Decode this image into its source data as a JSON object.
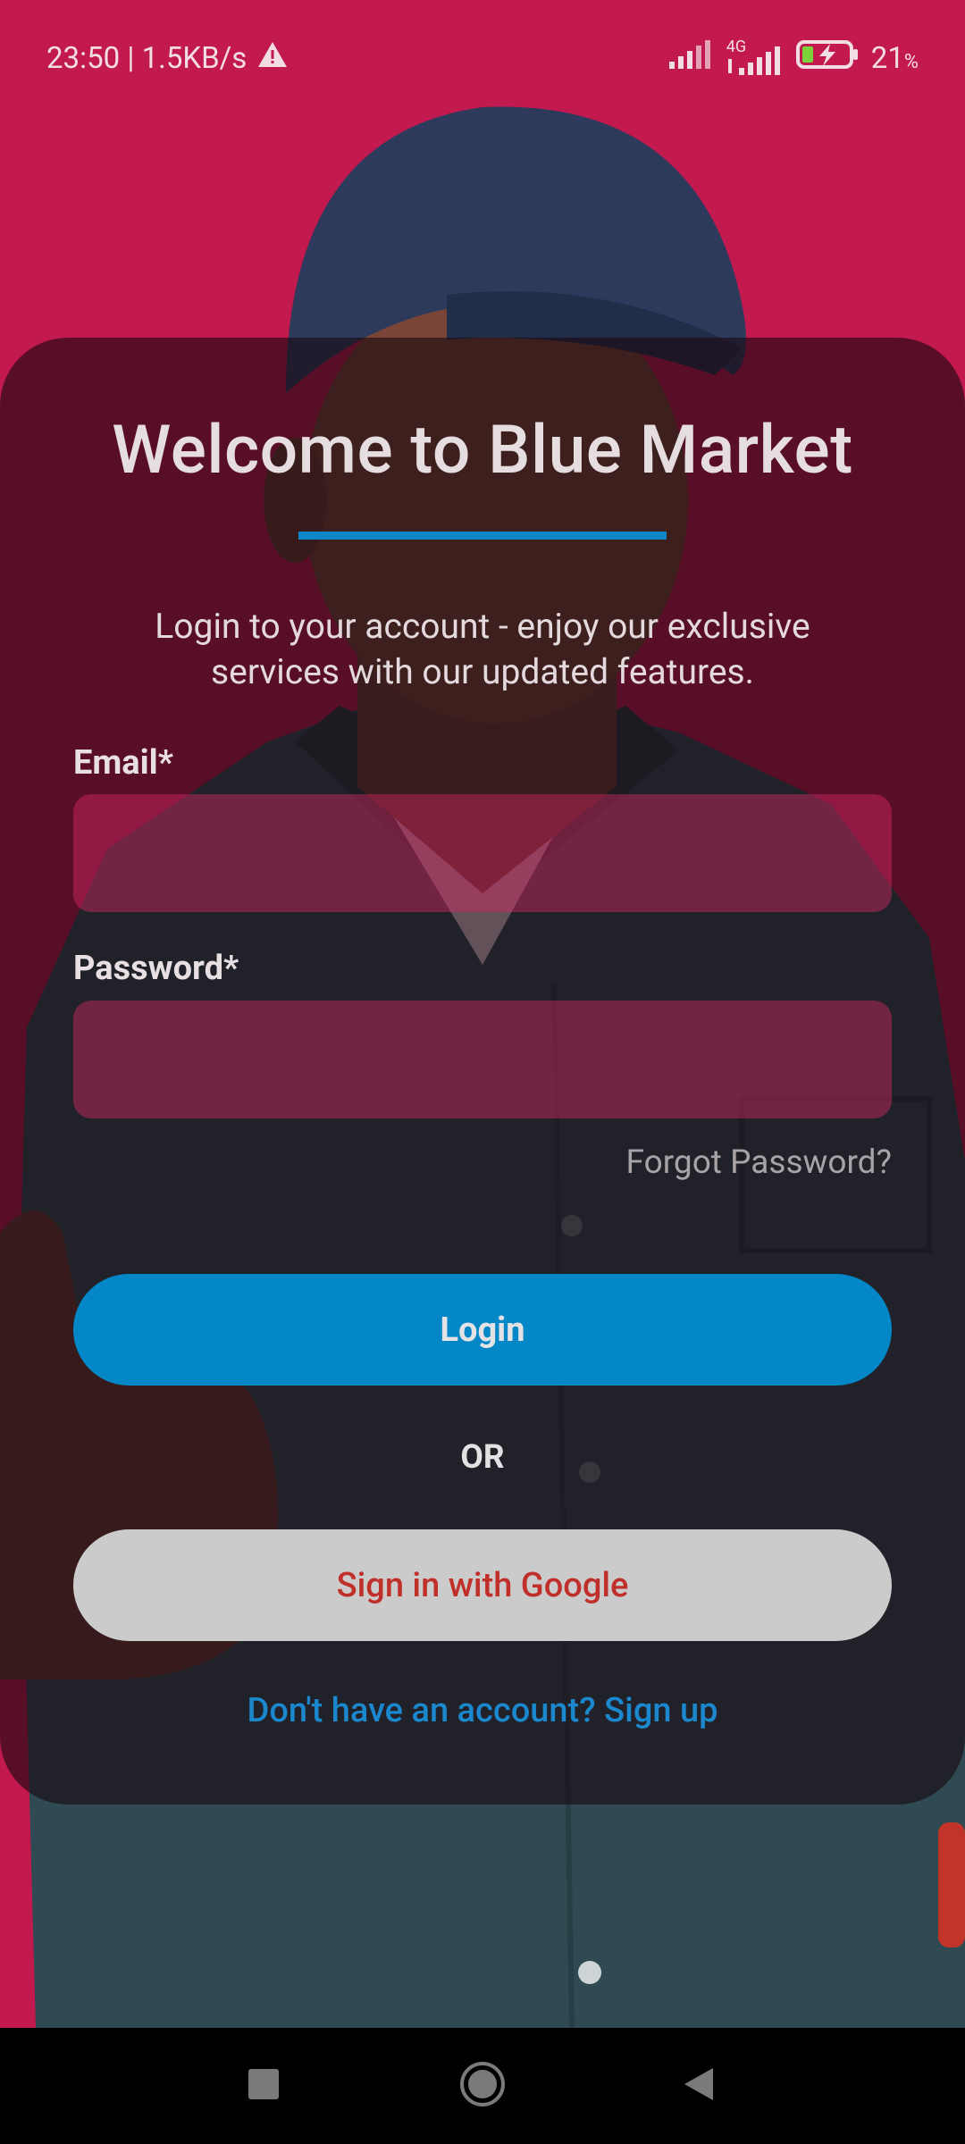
{
  "status_bar": {
    "time_speed": "23:50 | 1.5KB/s",
    "network": "4G",
    "battery": "21",
    "battery_unit": "%"
  },
  "login": {
    "title": "Welcome to Blue Market",
    "subtitle": "Login to your account - enjoy our exclusive services with our updated features.",
    "email_label": "Email*",
    "email_value": "",
    "password_label": "Password*",
    "password_value": "",
    "forgot_password": "Forgot Password?",
    "login_button": "Login",
    "or_text": "OR",
    "google_button": "Sign in with Google",
    "signup_link": "Don't have an account? Sign up"
  },
  "colors": {
    "background": "#c2194f",
    "accent_blue": "#0387c6",
    "google_text": "#c12f2a",
    "link": "#1b87cc"
  },
  "icons": {
    "warning": "warning-icon",
    "signal": "signal-icon",
    "battery": "battery-charging-icon",
    "nav_recents": "recents-square-icon",
    "nav_home": "home-circle-icon",
    "nav_back": "back-triangle-icon"
  }
}
